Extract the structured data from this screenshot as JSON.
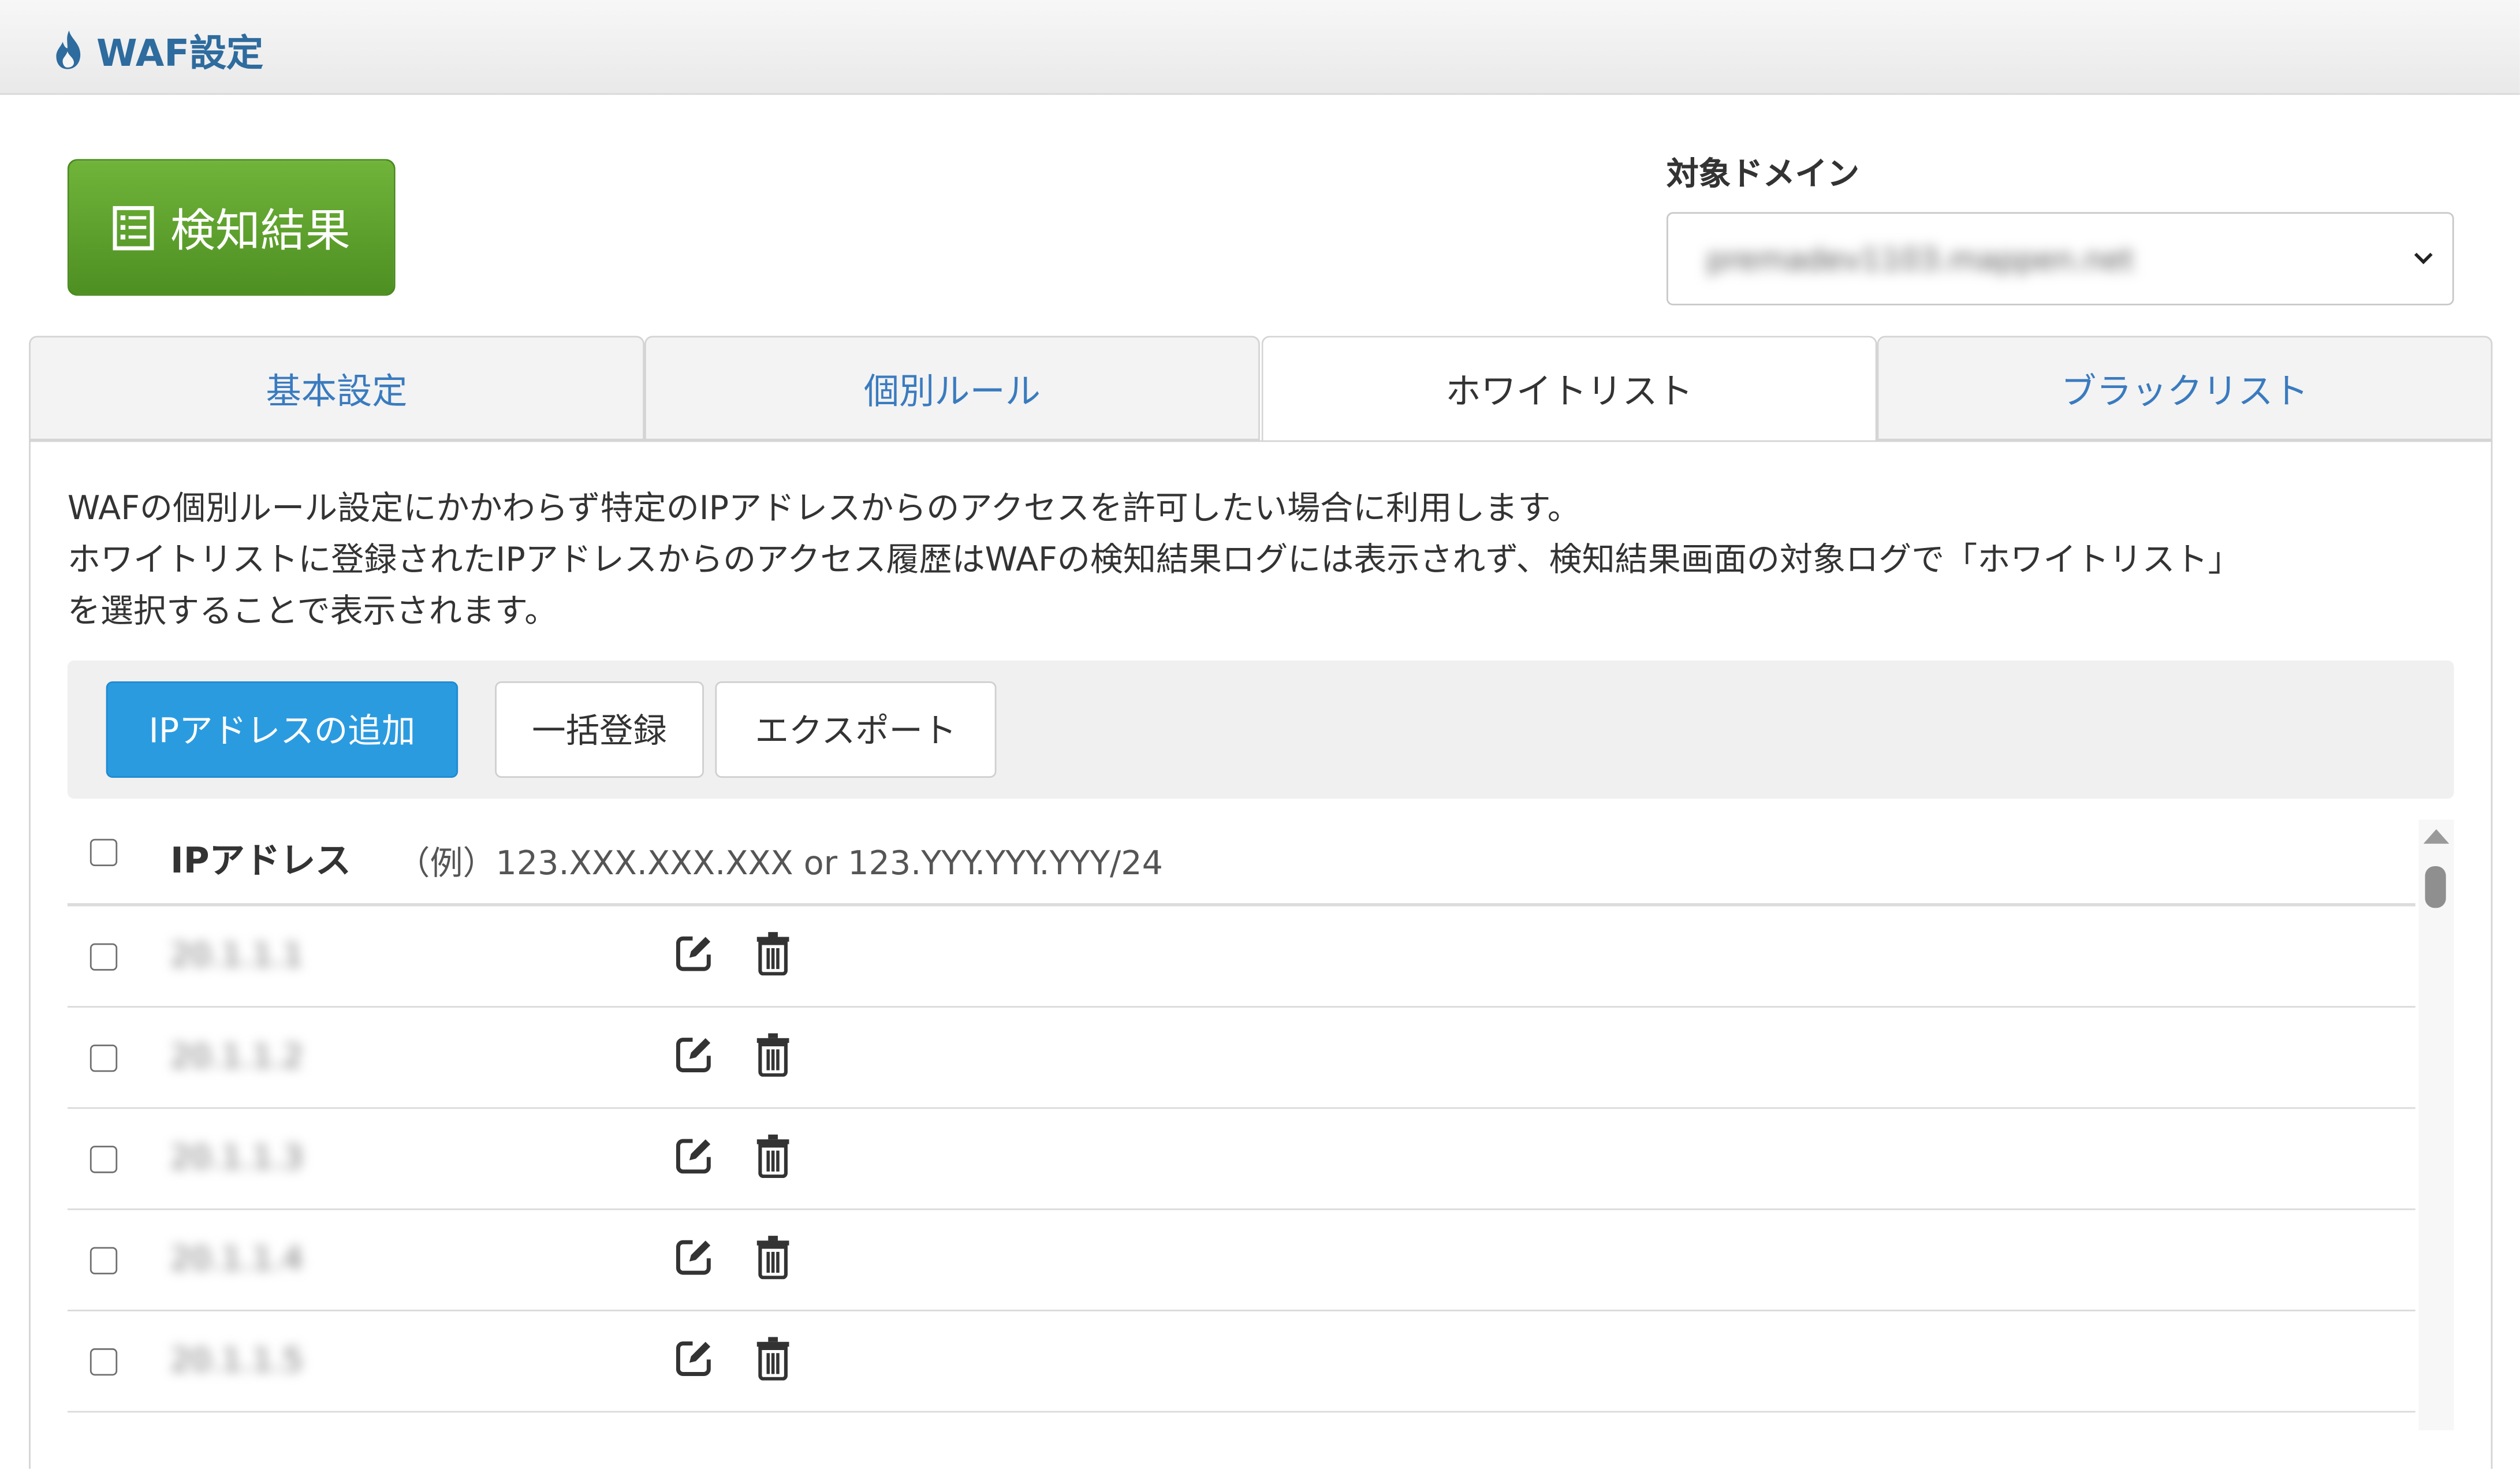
{
  "header": {
    "title": "WAF設定",
    "icon": "flame-icon"
  },
  "detect_button": {
    "label": "検知結果",
    "icon": "list-icon"
  },
  "domain": {
    "label": "対象ドメイン",
    "selected_value": "premadev1103.mappen.net"
  },
  "tabs": [
    {
      "label": "基本設定",
      "active": false
    },
    {
      "label": "個別ルール",
      "active": false
    },
    {
      "label": "ホワイトリスト",
      "active": true
    },
    {
      "label": "ブラックリスト",
      "active": false
    }
  ],
  "description": [
    "WAFの個別ルール設定にかかわらず特定のIPアドレスからのアクセスを許可したい場合に利用します。",
    "ホワイトリストに登録されたIPアドレスからのアクセス履歴はWAFの検知結果ログには表示されず、検知結果画面の対象ログで「ホワイトリスト」",
    "を選択することで表示されます。"
  ],
  "toolbar": {
    "add_label": "IPアドレスの追加",
    "bulk_label": "一括登録",
    "export_label": "エクスポート"
  },
  "list": {
    "header_label": "IPアドレス",
    "header_hint": "（例）123.XXX.XXX.XXX or 123.YYY.YYY.YYY/24",
    "rows": [
      {
        "ip": "20.1.1.1"
      },
      {
        "ip": "20.1.1.2"
      },
      {
        "ip": "20.1.1.3"
      },
      {
        "ip": "20.1.1.4"
      },
      {
        "ip": "20.1.1.5"
      }
    ]
  },
  "colors": {
    "accent_blue": "#2b9be0",
    "accent_green": "#5a9e2c",
    "tab_text": "#3a7bbf",
    "title_blue": "#2e6b9e"
  }
}
